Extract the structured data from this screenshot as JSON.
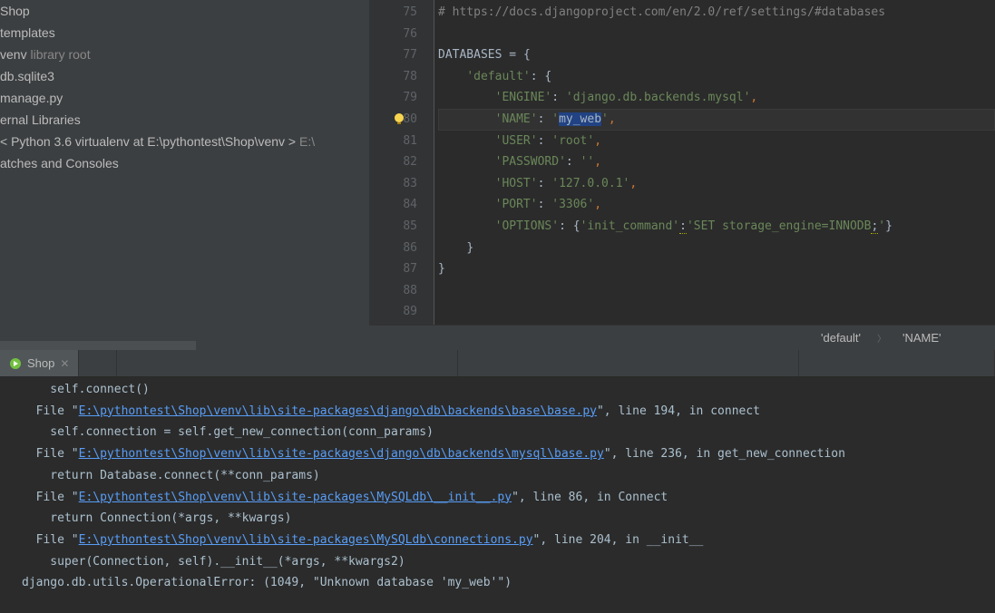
{
  "sidebar": {
    "items": [
      {
        "label": "Shop",
        "suffix": ""
      },
      {
        "label": "templates",
        "suffix": ""
      },
      {
        "label": "venv",
        "suffix": "library root"
      },
      {
        "label": "db.sqlite3",
        "suffix": ""
      },
      {
        "label": "manage.py",
        "suffix": ""
      },
      {
        "label": "ernal Libraries",
        "suffix": ""
      },
      {
        "label": "< Python 3.6 virtualenv at E:\\pythontest\\Shop\\venv >",
        "suffix": "E:\\"
      },
      {
        "label": "atches and Consoles",
        "suffix": ""
      }
    ]
  },
  "editor": {
    "startLine": 75,
    "lines": [
      {
        "n": 75,
        "segments": [
          [
            "# https://docs.djangoproject.com/en/2.0/ref/settings/#databases",
            "cmt"
          ]
        ]
      },
      {
        "n": 76,
        "segments": []
      },
      {
        "n": 77,
        "segments": [
          [
            "DATABASES ",
            "kw"
          ],
          [
            "= ",
            "op"
          ],
          [
            "{",
            "op"
          ]
        ]
      },
      {
        "n": 78,
        "segments": [
          [
            "    ",
            ""
          ],
          [
            "'default'",
            "str"
          ],
          [
            ": ",
            "op"
          ],
          [
            "{",
            "op"
          ]
        ]
      },
      {
        "n": 79,
        "segments": [
          [
            "        ",
            ""
          ],
          [
            "'ENGINE'",
            "str"
          ],
          [
            ": ",
            "op"
          ],
          [
            "'django.db.backends.mysql'",
            "str"
          ],
          [
            ",",
            "pun"
          ]
        ]
      },
      {
        "n": 80,
        "current": true,
        "bulb": true,
        "segments": [
          [
            "        ",
            ""
          ],
          [
            "'NAME'",
            "str"
          ],
          [
            ": ",
            "op"
          ],
          [
            "'",
            "str"
          ],
          [
            "my_web",
            "sel"
          ],
          [
            "'",
            "str"
          ],
          [
            ",",
            "pun"
          ]
        ]
      },
      {
        "n": 81,
        "segments": [
          [
            "        ",
            ""
          ],
          [
            "'USER'",
            "str"
          ],
          [
            ": ",
            "op"
          ],
          [
            "'root'",
            "str"
          ],
          [
            ",",
            "pun"
          ]
        ]
      },
      {
        "n": 82,
        "segments": [
          [
            "        ",
            ""
          ],
          [
            "'PASSWORD'",
            "str"
          ],
          [
            ": ",
            "op"
          ],
          [
            "''",
            "str"
          ],
          [
            ",",
            "pun"
          ]
        ]
      },
      {
        "n": 83,
        "segments": [
          [
            "        ",
            ""
          ],
          [
            "'HOST'",
            "str"
          ],
          [
            ": ",
            "op"
          ],
          [
            "'127.0.0.1'",
            "str"
          ],
          [
            ",",
            "pun"
          ]
        ]
      },
      {
        "n": 84,
        "segments": [
          [
            "        ",
            ""
          ],
          [
            "'PORT'",
            "str"
          ],
          [
            ": ",
            "op"
          ],
          [
            "'3306'",
            "str"
          ],
          [
            ",",
            "pun"
          ]
        ]
      },
      {
        "n": 85,
        "segments": [
          [
            "        ",
            ""
          ],
          [
            "'OPTIONS'",
            "str"
          ],
          [
            ": ",
            "op"
          ],
          [
            "{",
            "op"
          ],
          [
            "'init_command'",
            "str"
          ],
          [
            ":",
            "op warn"
          ],
          [
            "'SET storage_engine=INNODB",
            "str"
          ],
          [
            ";",
            "op warn"
          ],
          [
            "'",
            "str"
          ],
          [
            "}",
            "op"
          ]
        ]
      },
      {
        "n": 86,
        "segments": [
          [
            "    ",
            ""
          ],
          [
            "}",
            "op"
          ]
        ]
      },
      {
        "n": 87,
        "segments": [
          [
            "}",
            "op"
          ]
        ]
      },
      {
        "n": 88,
        "segments": []
      },
      {
        "n": 89,
        "segments": []
      }
    ]
  },
  "breadcrumb": {
    "a": "'default'",
    "b": "'NAME'"
  },
  "tab": {
    "label": "Shop"
  },
  "console": {
    "lines": [
      {
        "t": "    self.connect()",
        "cls": ""
      },
      {
        "t": "  File \"",
        "link": "E:\\pythontest\\Shop\\venv\\lib\\site-packages\\django\\db\\backends\\base\\base.py",
        "tail": "\", line 194, in connect"
      },
      {
        "t": "    self.connection = self.get_new_connection(conn_params)",
        "cls": ""
      },
      {
        "t": "  File \"",
        "link": "E:\\pythontest\\Shop\\venv\\lib\\site-packages\\django\\db\\backends\\mysql\\base.py",
        "tail": "\", line 236, in get_new_connection"
      },
      {
        "t": "    return Database.connect(**conn_params)",
        "cls": ""
      },
      {
        "t": "  File \"",
        "link": "E:\\pythontest\\Shop\\venv\\lib\\site-packages\\MySQLdb\\__init__.py",
        "tail": "\", line 86, in Connect"
      },
      {
        "t": "    return Connection(*args, **kwargs)",
        "cls": ""
      },
      {
        "t": "  File \"",
        "link": "E:\\pythontest\\Shop\\venv\\lib\\site-packages\\MySQLdb\\connections.py",
        "tail": "\", line 204, in __init__"
      },
      {
        "t": "    super(Connection, self).__init__(*args, **kwargs2)",
        "cls": ""
      },
      {
        "t": "django.db.utils.OperationalError: (1049, \"Unknown database 'my_web'\")",
        "cls": ""
      }
    ]
  }
}
